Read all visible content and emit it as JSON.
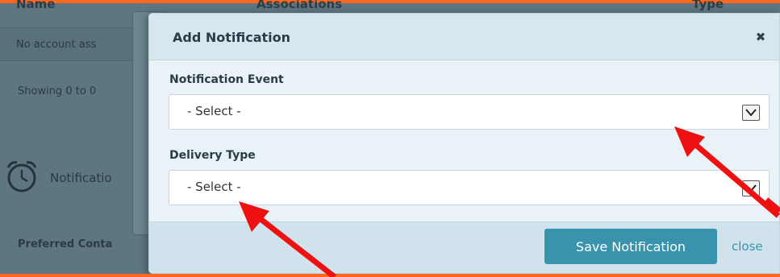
{
  "background": {
    "table_headers": [
      "Name",
      "Associations",
      "Type"
    ],
    "empty_row_text": "No account ass",
    "showing_text": "Showing 0 to 0",
    "notifications_label": "Notificatio",
    "preferred_contact_label": "Preferred Conta"
  },
  "modal": {
    "title": "Add Notification",
    "close_glyph": "✖",
    "fields": [
      {
        "label": "Notification Event",
        "value": "- Select -"
      },
      {
        "label": "Delivery Type",
        "value": "- Select -"
      }
    ],
    "save_label": "Save Notification",
    "close_label": "close"
  },
  "icons": [
    "alarm-clock-icon",
    "close-icon",
    "chevron-down-icon"
  ],
  "colors": {
    "accent": "#ff6620",
    "primary_button": "#3a93ad",
    "annotation_arrow": "#ee1111"
  }
}
